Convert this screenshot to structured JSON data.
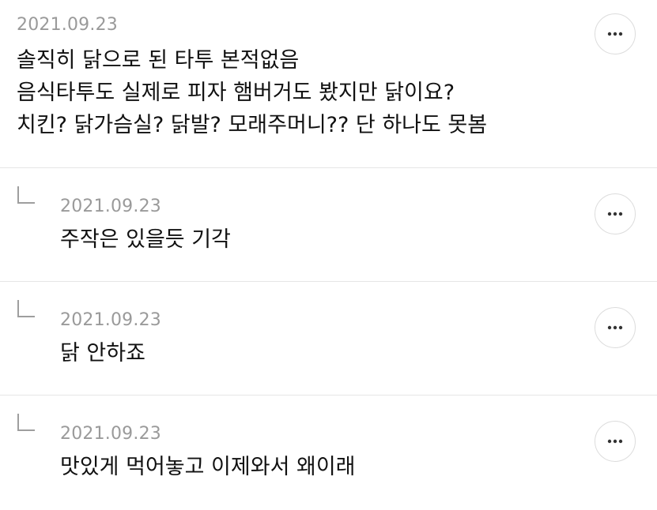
{
  "comments": [
    {
      "date": "2021.09.23",
      "lines": [
        "솔직히 닭으로 된 타투 본적없음",
        "음식타투도 실제로 피자 햄버거도 봤지만 닭이요?",
        "치킨? 닭가슴실? 닭발? 모래주머니?? 단 하나도 못봄"
      ],
      "more_icon": "more-horizontal-icon"
    }
  ],
  "replies": [
    {
      "date": "2021.09.23",
      "text": "주작은 있을듯 기각",
      "reply_icon": "reply-arrow-icon",
      "more_icon": "more-horizontal-icon"
    },
    {
      "date": "2021.09.23",
      "text": "닭 안하죠",
      "reply_icon": "reply-arrow-icon",
      "more_icon": "more-horizontal-icon"
    },
    {
      "date": "2021.09.23",
      "text": "맛있게 먹어놓고 이제와서 왜이래",
      "reply_icon": "reply-arrow-icon",
      "more_icon": "more-horizontal-icon"
    }
  ],
  "colors": {
    "date": "#9a9a9a",
    "text": "#111111",
    "divider": "#e6e6e6",
    "button_border": "#dcdcdc"
  }
}
